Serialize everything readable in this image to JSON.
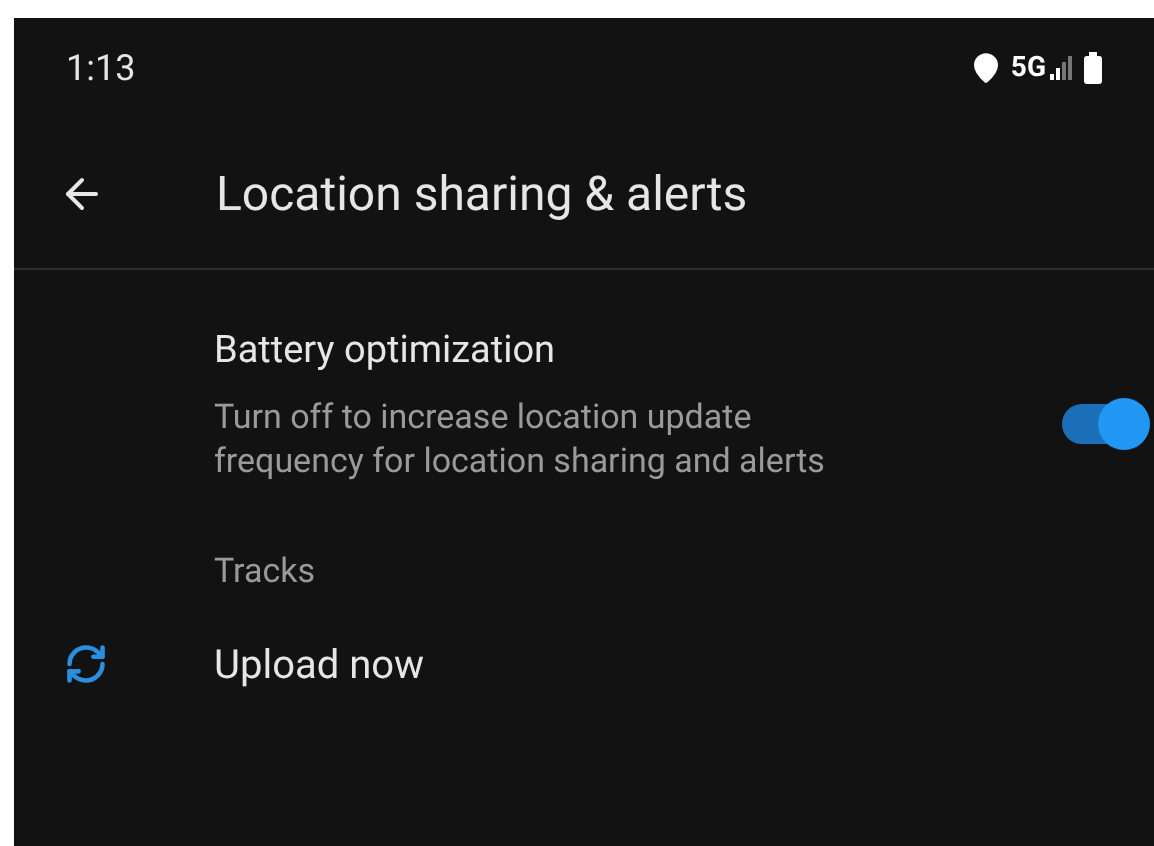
{
  "status_bar": {
    "time": "1:13",
    "network": "5G"
  },
  "header": {
    "title": "Location sharing & alerts"
  },
  "settings": [
    {
      "kind": "switch",
      "title": "Battery optimization",
      "summary": "Turn off to increase location update frequency for location sharing and alerts",
      "on": true
    },
    {
      "kind": "category",
      "title": "Tracks"
    },
    {
      "kind": "action",
      "title": "Upload now"
    }
  ]
}
